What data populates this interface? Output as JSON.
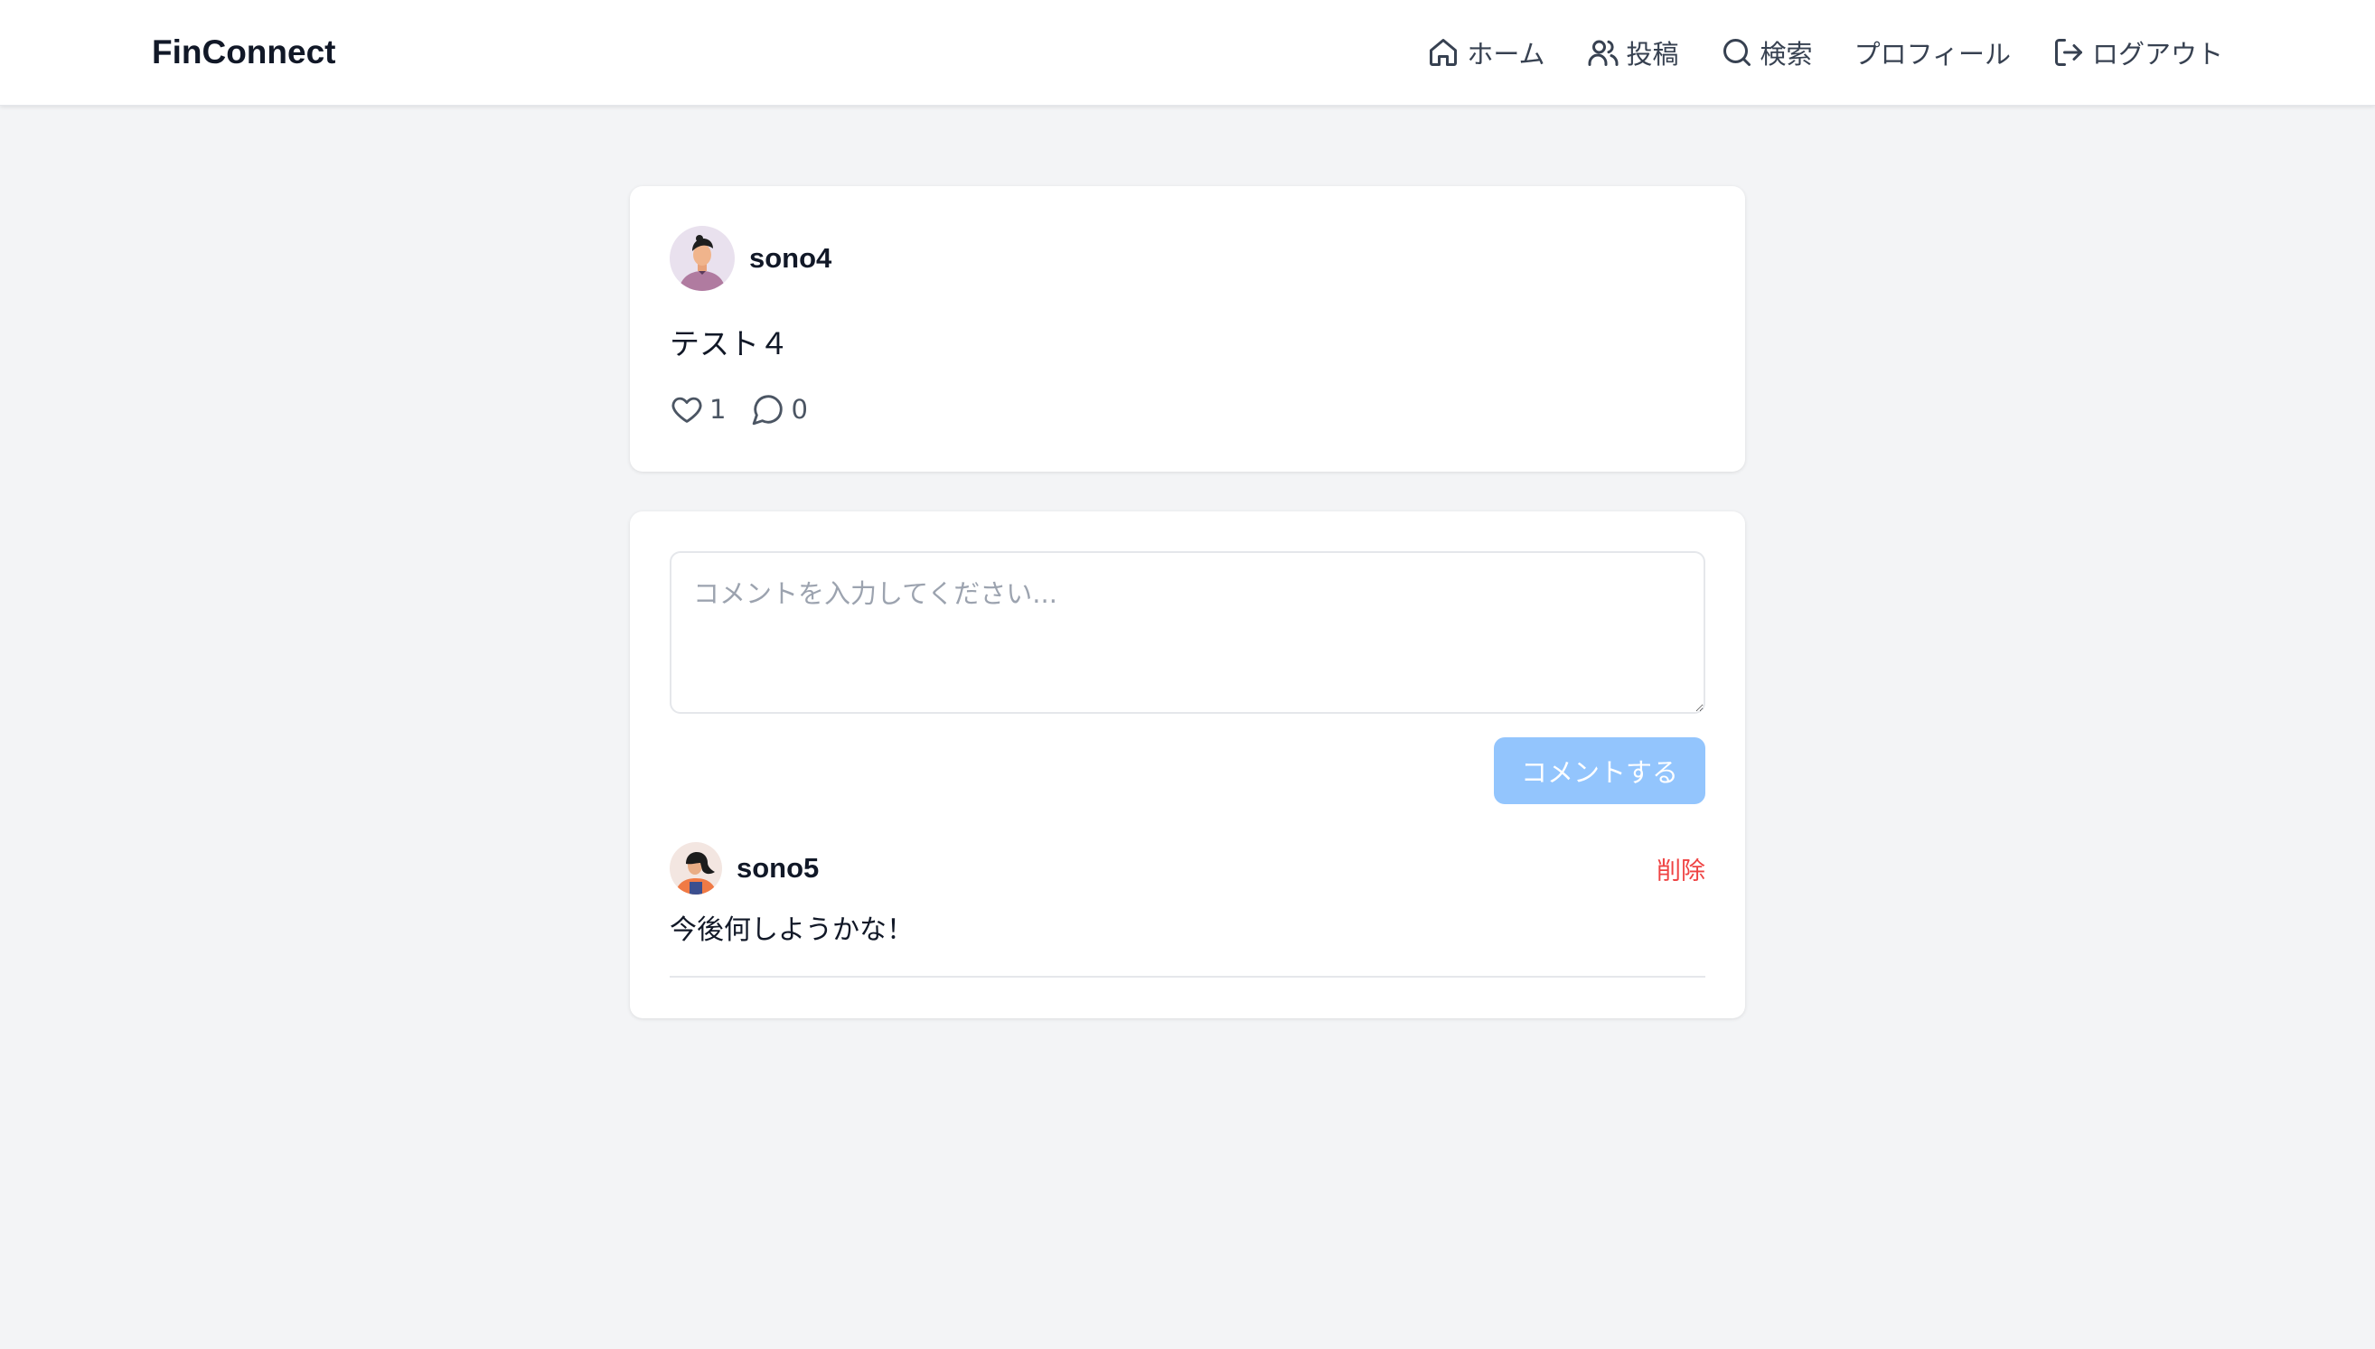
{
  "header": {
    "brand": "FinConnect",
    "nav": [
      {
        "label": "ホーム",
        "icon": "home-icon"
      },
      {
        "label": "投稿",
        "icon": "users-icon"
      },
      {
        "label": "検索",
        "icon": "search-icon"
      },
      {
        "label": "プロフィール",
        "icon": ""
      },
      {
        "label": "ログアウト",
        "icon": "logout-icon"
      }
    ]
  },
  "post": {
    "username": "sono4",
    "text": "テスト４",
    "likes": "1",
    "comments": "0"
  },
  "comment_form": {
    "placeholder": "コメントを入力してください...",
    "submit_label": "コメントする"
  },
  "comments": [
    {
      "username": "sono5",
      "text": "今後何しようかな！",
      "delete_label": "削除"
    }
  ],
  "colors": {
    "accent_disabled": "#93c5fd",
    "danger": "#ef4444",
    "background": "#f3f4f6"
  }
}
